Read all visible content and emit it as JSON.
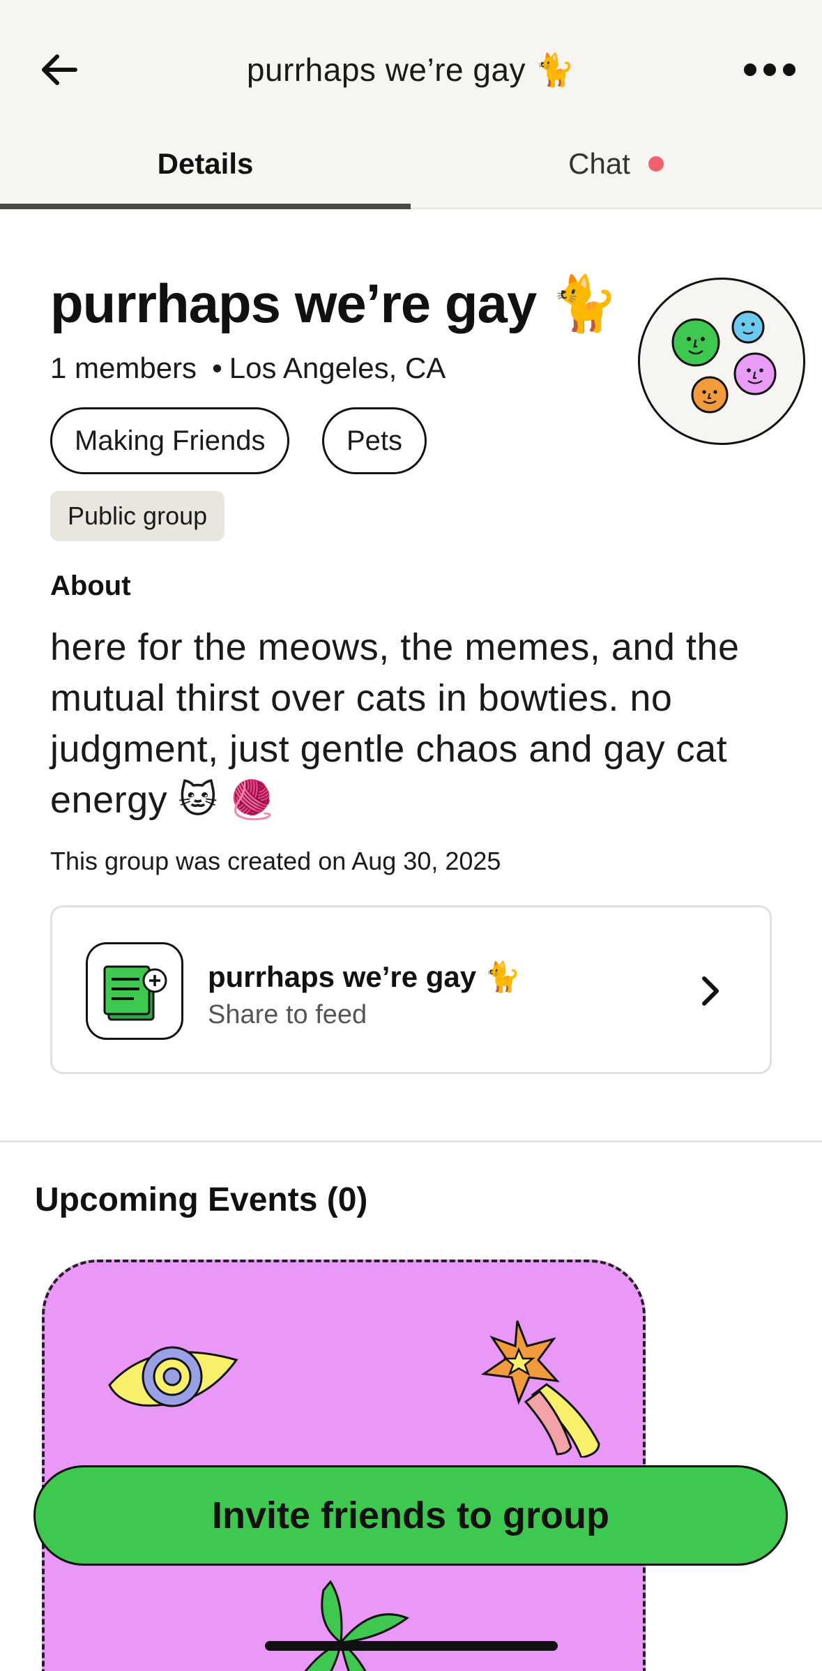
{
  "header": {
    "title": "purrhaps we’re gay 🐈",
    "back_icon": "arrow-left-icon",
    "more_icon": "more-horizontal-icon"
  },
  "tabs": [
    {
      "label": "Details",
      "active": true
    },
    {
      "label": "Chat",
      "active": false,
      "notification_dot": true
    }
  ],
  "group": {
    "name": "purrhaps we’re gay 🐈",
    "members": "1 members",
    "location": "Los Angeles, CA",
    "tags": [
      "Making Friends",
      "Pets"
    ],
    "visibility": "Public group",
    "about_heading": "About",
    "about_text": "here for the meows, the memes, and the mutual thirst over cats in bowties. no judgment, just gentle chaos and gay cat energy 🐱 🧶",
    "created": "This group was created on Aug 30, 2025"
  },
  "share_card": {
    "title": "purrhaps we’re gay 🐈",
    "subtitle": "Share to feed",
    "icon": "share-feed-icon"
  },
  "events": {
    "heading": "Upcoming Events (0)"
  },
  "cta": {
    "invite_label": "Invite friends to group"
  },
  "colors": {
    "header_bg": "#f6f5f2",
    "accent_green": "#3fc84f",
    "event_card_bg": "#ea98f7",
    "notification_dot": "#f2606d",
    "badge_bg": "#e8e6df"
  }
}
